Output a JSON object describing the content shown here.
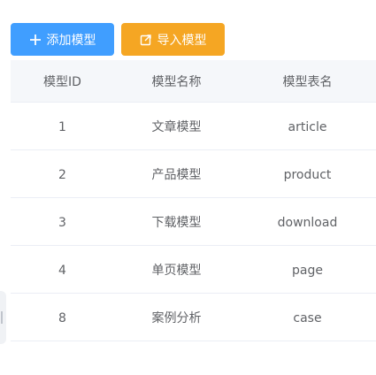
{
  "toolbar": {
    "add_label": "添加模型",
    "import_label": "导入模型",
    "add_color": "#409eff",
    "import_color": "#f5a623"
  },
  "table": {
    "headers": [
      "模型ID",
      "模型名称",
      "模型表名"
    ],
    "rows": [
      {
        "id": "1",
        "name": "文章模型",
        "table": "article"
      },
      {
        "id": "2",
        "name": "产品模型",
        "table": "product"
      },
      {
        "id": "3",
        "name": "下载模型",
        "table": "download"
      },
      {
        "id": "4",
        "name": "单页模型",
        "table": "page"
      },
      {
        "id": "8",
        "name": "案例分析",
        "table": "case"
      }
    ]
  }
}
